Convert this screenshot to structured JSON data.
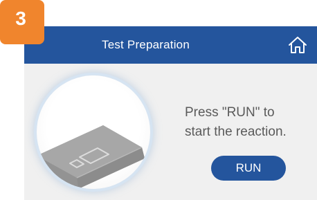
{
  "step_badge": {
    "number": "3",
    "color": "#f0852d"
  },
  "header": {
    "title": "Test Preparation",
    "background_color": "#24559d",
    "home_icon": "home-icon"
  },
  "illustration": {
    "icon": "analyzer-device-illustration"
  },
  "instruction": {
    "line1": "Press \"RUN\" to",
    "line2": "start the reaction."
  },
  "run_button": {
    "label": "RUN",
    "color": "#24559d"
  }
}
